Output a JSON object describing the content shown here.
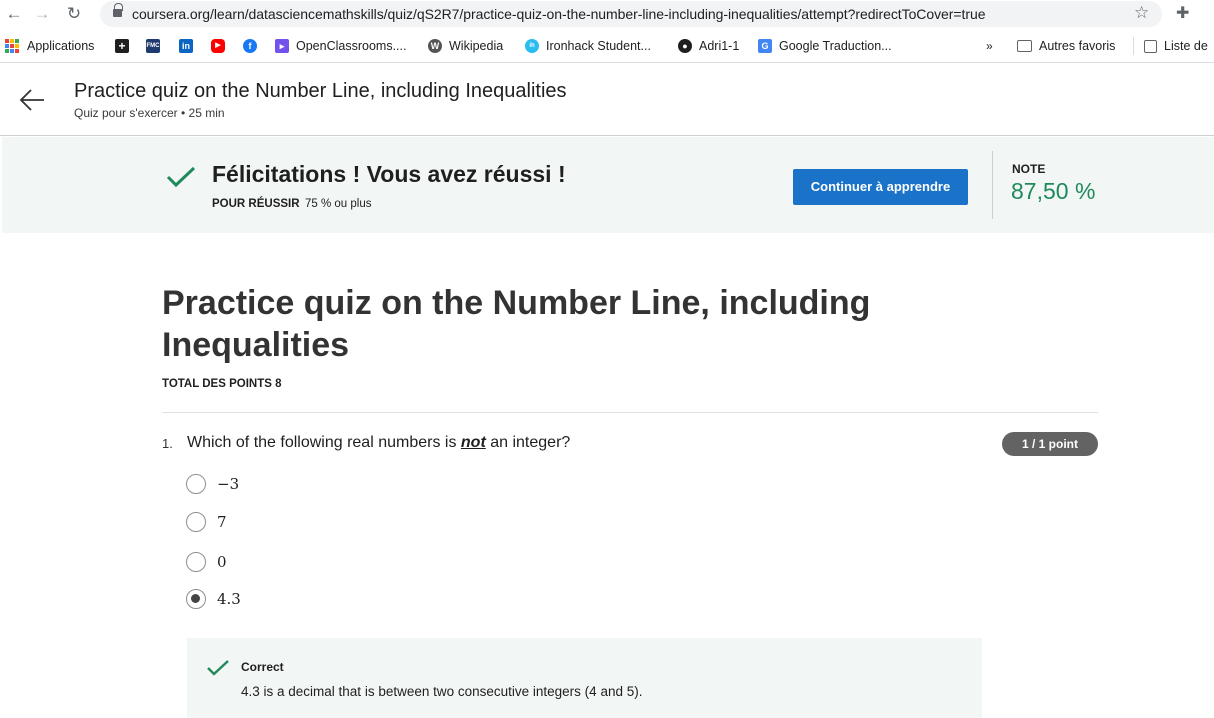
{
  "browser": {
    "url": "coursera.org/learn/datasciencemathskills/quiz/qS2R7/practice-quiz-on-the-number-line-including-inequalities/attempt?redirectToCover=true",
    "bookmarks": [
      {
        "label": "Applications",
        "icon": "apps-grid-icon"
      },
      {
        "label": "",
        "icon": "plus-square-icon"
      },
      {
        "label": "",
        "icon": "fmc-icon"
      },
      {
        "label": "",
        "icon": "linkedin-icon"
      },
      {
        "label": "",
        "icon": "youtube-icon"
      },
      {
        "label": "",
        "icon": "facebook-icon"
      },
      {
        "label": "OpenClassrooms....",
        "icon": "openclassrooms-icon"
      },
      {
        "label": "Wikipedia",
        "icon": "wikipedia-icon"
      },
      {
        "label": "Ironhack Student...",
        "icon": "ironhack-icon"
      },
      {
        "label": "Adri1-1",
        "icon": "github-icon"
      },
      {
        "label": "Google Traduction...",
        "icon": "google-translate-icon"
      }
    ],
    "more": "»",
    "other_bookmarks": "Autres favoris",
    "reading_list": "Liste de"
  },
  "header": {
    "title": "Practice quiz on the Number Line, including Inequalities",
    "subtitle": "Quiz pour s'exercer • 25 min"
  },
  "result": {
    "message": "Félicitations ! Vous avez réussi !",
    "pass_label": "POUR RÉUSSIR",
    "pass_value": "75 % ou plus",
    "continue_button": "Continuer à apprendre",
    "grade_label": "NOTE",
    "grade_value": "87,50 %"
  },
  "quiz": {
    "title": "Practice quiz on the Number Line, including Inequalities",
    "total_points": "TOTAL DES POINTS 8",
    "question": {
      "number": "1.",
      "text_before": "Which of the following real numbers is ",
      "text_emphasis": "not",
      "text_after": " an integer?",
      "points": "1 / 1 point",
      "options": [
        {
          "label": "−3",
          "selected": false
        },
        {
          "label": "7",
          "selected": false
        },
        {
          "label": "0",
          "selected": false
        },
        {
          "label": "4.3",
          "selected": true
        }
      ],
      "feedback": {
        "title": "Correct",
        "text": "4.3 is a decimal that is between two consecutive integers (4 and 5)."
      }
    }
  },
  "colors": {
    "accent": "#1a73c8",
    "success": "#1e8a5a",
    "banner_bg": "#f2f6f5",
    "badge": "#636363"
  }
}
